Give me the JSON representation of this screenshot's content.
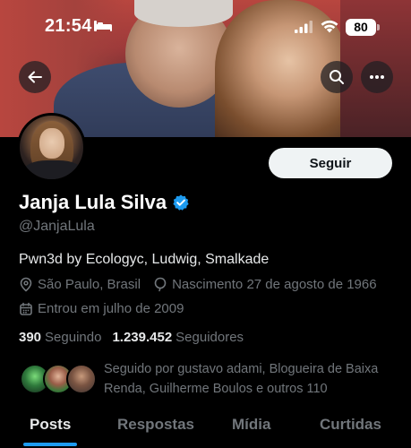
{
  "status_bar": {
    "time": "21:54",
    "battery": "80"
  },
  "header": {
    "back_icon": "arrow-left-icon",
    "search_icon": "search-icon",
    "more_icon": "more-horizontal-icon"
  },
  "profile": {
    "follow_label": "Seguir",
    "name": "Janja Lula Silva",
    "verified": true,
    "verified_color": "#1d9bf0",
    "handle": "@JanjaLula",
    "bio": "Pwn3d by Ecologyc, Ludwig, Smalkade",
    "location": "São Paulo, Brasil",
    "birth": "Nascimento 27 de agosto de 1966",
    "joined": "Entrou em julho de 2009",
    "following_count": "390",
    "following_label": "Seguindo",
    "followers_count": "1.239.452",
    "followers_label": "Seguidores",
    "followed_by": "Seguido por gustavo adami, Blogueira de Baixa Renda, Guilherme Boulos e outros 110"
  },
  "tabs": [
    {
      "label": "Posts",
      "active": true
    },
    {
      "label": "Respostas",
      "active": false
    },
    {
      "label": "Mídia",
      "active": false
    },
    {
      "label": "Curtidas",
      "active": false
    }
  ],
  "colors": {
    "accent": "#1d9bf0",
    "background": "#000000",
    "secondary_text": "#71767b"
  }
}
